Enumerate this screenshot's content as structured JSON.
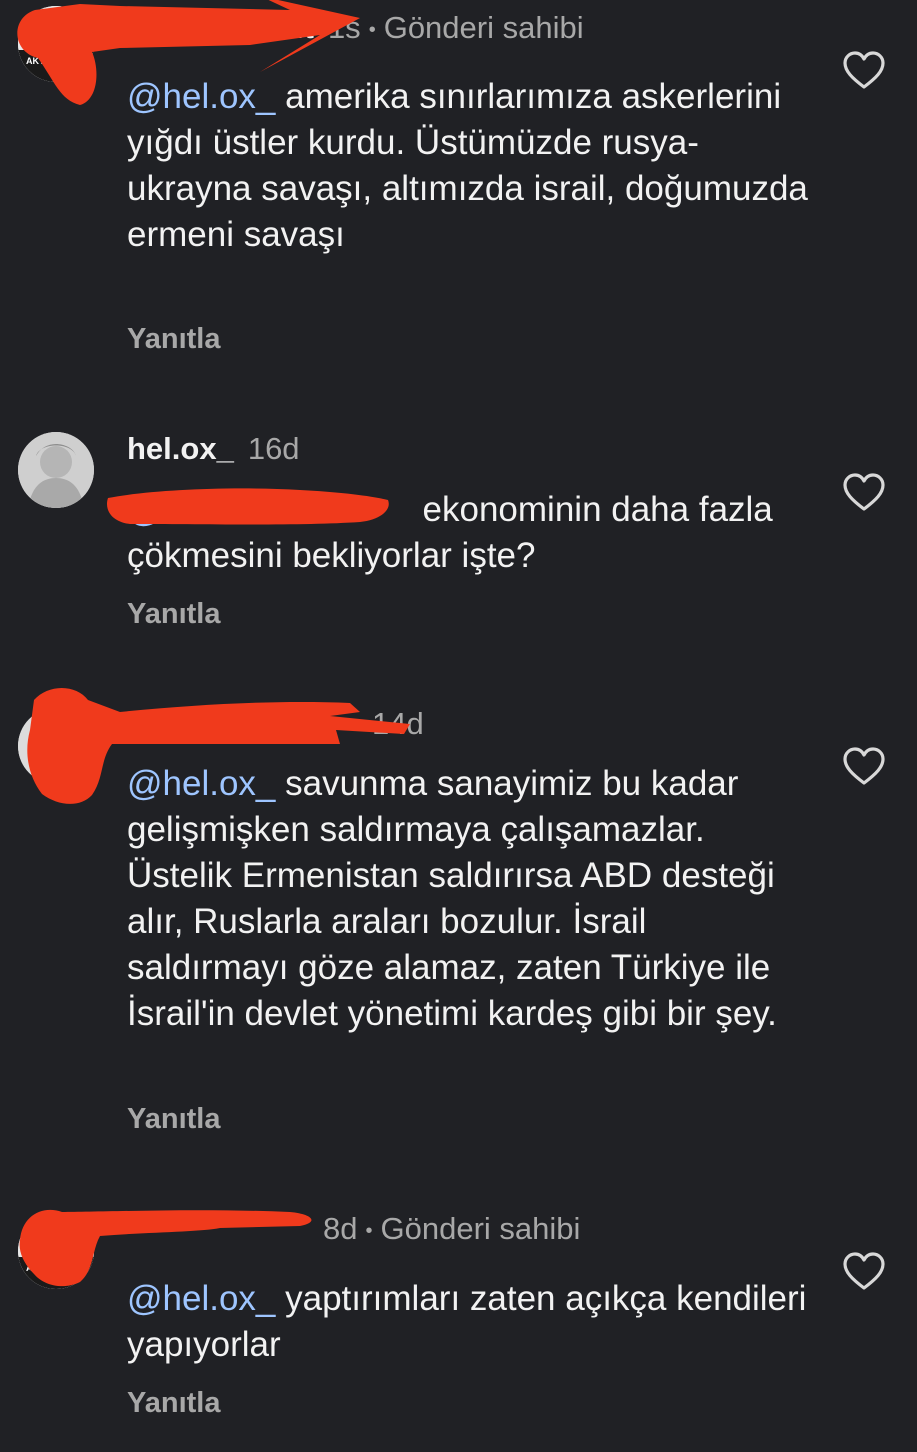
{
  "comments": [
    {
      "username": "it",
      "time": "1s",
      "owner_label": "Gönderi sahibi",
      "mention": "@hel.ox_",
      "text": " amerika sınırlarımıza askerlerini yığdı üstler kurdu. Üstümüzde rusya-ukrayna savaşı, altımızda israil, doğumuzda ermeni savaşı",
      "reply_label": "Yanıtla"
    },
    {
      "username": "hel.ox_",
      "time": "16d",
      "mention": "@",
      "text": "ekonominin daha fazla çökmesini bekliyorlar işte?",
      "reply_label": "Yanıtla"
    },
    {
      "username": "",
      "time": "14d",
      "mention": "@hel.ox_",
      "text": " savunma sanayimiz bu kadar gelişmişken saldırmaya çalışamazlar. Üstelik Ermenistan saldırırsa ABD desteği alır, Ruslarla araları bozulur. İsrail saldırmayı göze alamaz, zaten Türkiye ile İsrail'in devlet yönetimi kardeş gibi bir şey.",
      "reply_label": "Yanıtla"
    },
    {
      "username": "",
      "time": "8d",
      "owner_label": "Gönderi sahibi",
      "mention": "@hel.ox_",
      "text": " yaptırımları zaten açıkça kendileri yapıyorlar",
      "reply_label": "Yanıtla"
    }
  ],
  "colors": {
    "background": "#202125",
    "text": "#f2f2f2",
    "muted": "#a8a8a8",
    "mention": "#9ec5ff",
    "redaction": "#f03a1c"
  },
  "icons": {
    "like": "heart-outline-icon"
  }
}
